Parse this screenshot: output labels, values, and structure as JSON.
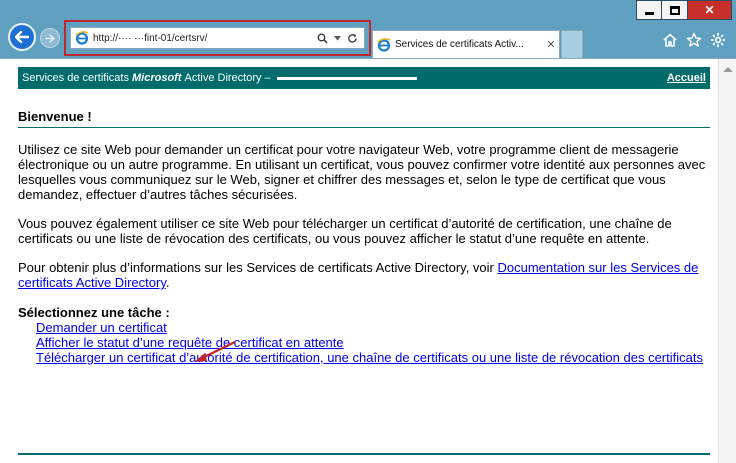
{
  "browser": {
    "url": "http://···· ···fint-01/certsrv/",
    "tab_title": "Services de certificats Activ...",
    "tab_close": "✕",
    "window_controls": {
      "minimize": "minimize-icon",
      "maximize": "maximize-icon",
      "close": "✕"
    },
    "right_icons": [
      "home-icon",
      "favorites-star-icon",
      "settings-gear-icon"
    ]
  },
  "banner": {
    "prefix": "Services de certificats",
    "brand": "Microsoft",
    "suffix": "Active Directory  –",
    "home_link": "Accueil"
  },
  "page": {
    "welcome": "Bienvenue !",
    "paragraph1": "Utilisez ce site Web pour demander un certificat pour votre navigateur Web, votre programme client de messagerie électronique ou un autre programme. En utilisant un certificat, vous pouvez confirmer votre identité aux personnes avec lesquelles vous communiquez sur le Web, signer et chiffrer des messages et, selon le type de certificat que vous demandez, effectuer d’autres tâches sécurisées.",
    "paragraph2": "Vous pouvez également utiliser ce site Web pour télécharger un certificat d’autorité de certification, une chaîne de certificats ou une liste de révocation des certificats, ou vous pouvez afficher le statut d’une requête en attente.",
    "paragraph3_text": "Pour obtenir plus d’informations sur les Services de certificats Active Directory, voir ",
    "paragraph3_link": "Documentation sur les Services de certificats Active Directory",
    "paragraph3_end": ".",
    "task_title": "Sélectionnez une tâche :",
    "tasks": [
      "Demander un certificat",
      "Afficher le statut d’une requête de certificat en attente",
      "Télécharger un certificat d’autorité de certification, une chaîne de certificats ou une liste de révocation des certificats"
    ]
  },
  "colors": {
    "chrome": "#5f9fc0",
    "banner": "#006b6b",
    "link": "#0000ee",
    "highlight": "#c0262d"
  }
}
